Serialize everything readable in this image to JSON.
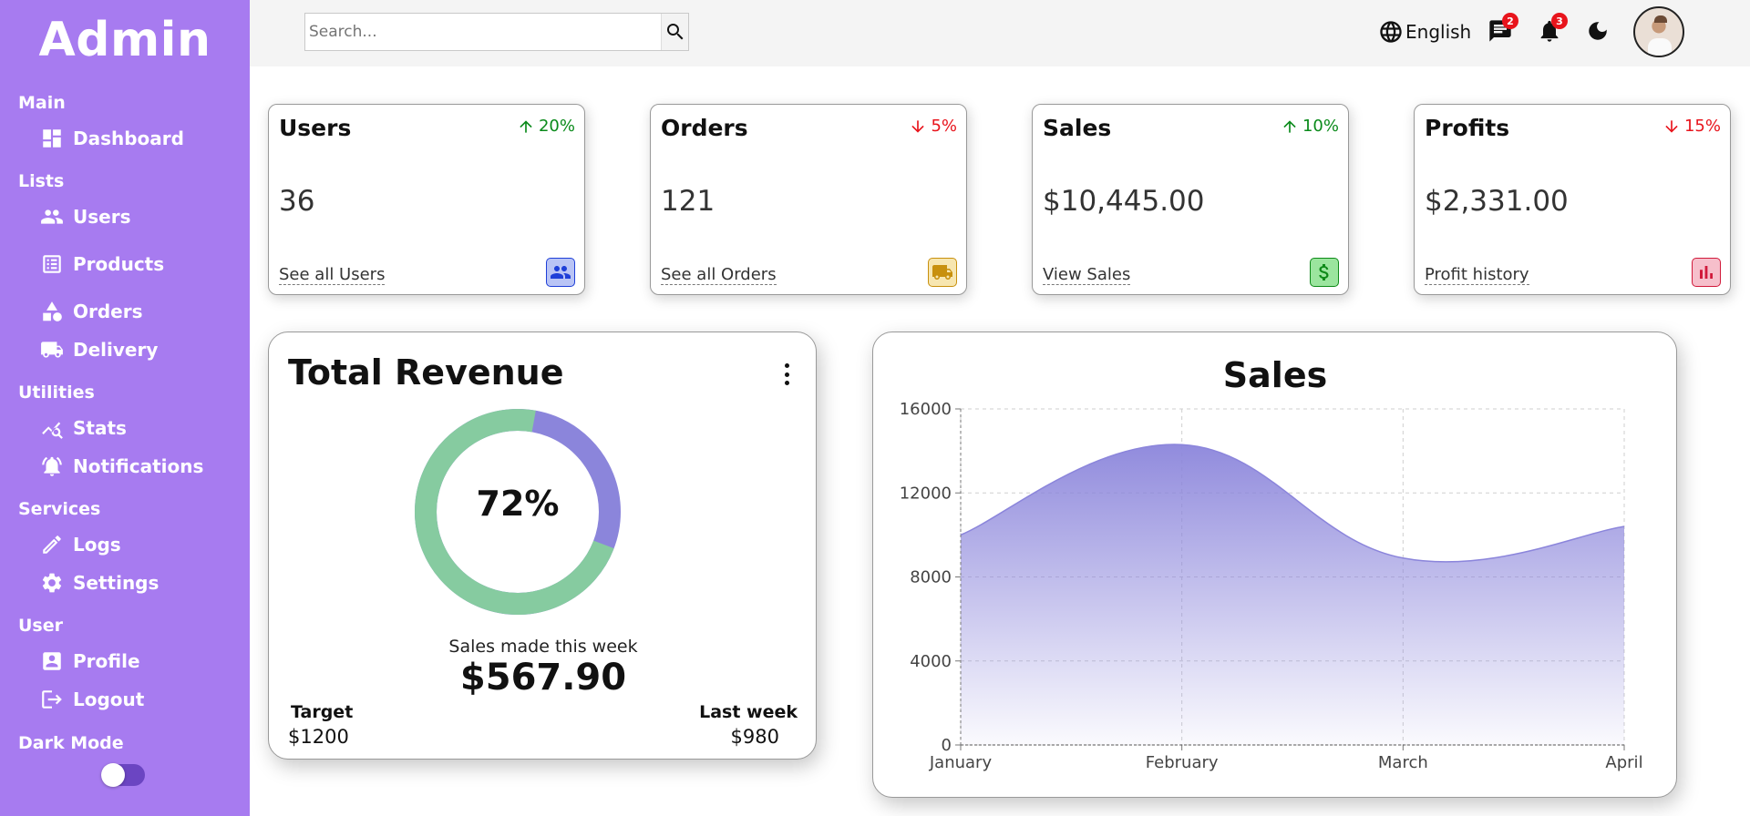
{
  "sidebar": {
    "brand": "Admin",
    "sections": {
      "main": "Main",
      "lists": "Lists",
      "utilities": "Utilities",
      "services": "Services",
      "user": "User",
      "dark_mode": "Dark Mode"
    },
    "items": {
      "dashboard": "Dashboard",
      "users": "Users",
      "products": "Products",
      "orders": "Orders",
      "delivery": "Delivery",
      "stats": "Stats",
      "notifications": "Notifications",
      "logs": "Logs",
      "settings": "Settings",
      "profile": "Profile",
      "logout": "Logout"
    },
    "dark_mode_on": false
  },
  "topbar": {
    "search_placeholder": "Search...",
    "language": "English",
    "messages_count": "2",
    "notifications_count": "3",
    "icons": [
      "search-icon",
      "globe-icon",
      "chat-icon",
      "bell-icon",
      "moon-icon",
      "avatar"
    ]
  },
  "kpis": [
    {
      "title": "Users",
      "trend": "20%",
      "direction": "up",
      "value": "36",
      "link": "See all Users",
      "icon": "users-icon",
      "icon_color": "#1e3fd8",
      "icon_bg": "#b9c4f5"
    },
    {
      "title": "Orders",
      "trend": "5%",
      "direction": "down",
      "value": "121",
      "link": "See all Orders",
      "icon": "truck-icon",
      "icon_color": "#c8900d",
      "icon_bg": "#f7e6b0"
    },
    {
      "title": "Sales",
      "trend": "10%",
      "direction": "up",
      "value": "$10,445.00",
      "link": "View Sales",
      "icon": "dollar-icon",
      "icon_color": "#0e8a18",
      "icon_bg": "#9be59e"
    },
    {
      "title": "Profits",
      "trend": "15%",
      "direction": "down",
      "value": "$2,331.00",
      "link": "Profit history",
      "icon": "bar-chart-icon",
      "icon_color": "#d11a3b",
      "icon_bg": "#f6bfcb"
    }
  ],
  "colors": {
    "sidebar": "#a77bf0",
    "up": "#0a8a1a",
    "down": "#e8141c",
    "donut_main": "#86cba0",
    "donut_rest": "#8b85db",
    "area": "#8b85db"
  },
  "revenue": {
    "title": "Total Revenue",
    "percent": "72%",
    "percent_value": 72,
    "subtitle": "Sales made this week",
    "amount": "$567.90",
    "target_label": "Target",
    "target_value": "$1200",
    "lastweek_label": "Last week",
    "lastweek_value": "$980"
  },
  "chart_data": {
    "type": "area",
    "title": "Sales",
    "categories": [
      "January",
      "February",
      "March",
      "April"
    ],
    "values": [
      10000,
      14300,
      8900,
      10400
    ],
    "ylim": [
      0,
      16000
    ],
    "yticks": [
      "0",
      "4000",
      "8000",
      "12000",
      "16000"
    ],
    "grid": true,
    "legend": "none"
  }
}
